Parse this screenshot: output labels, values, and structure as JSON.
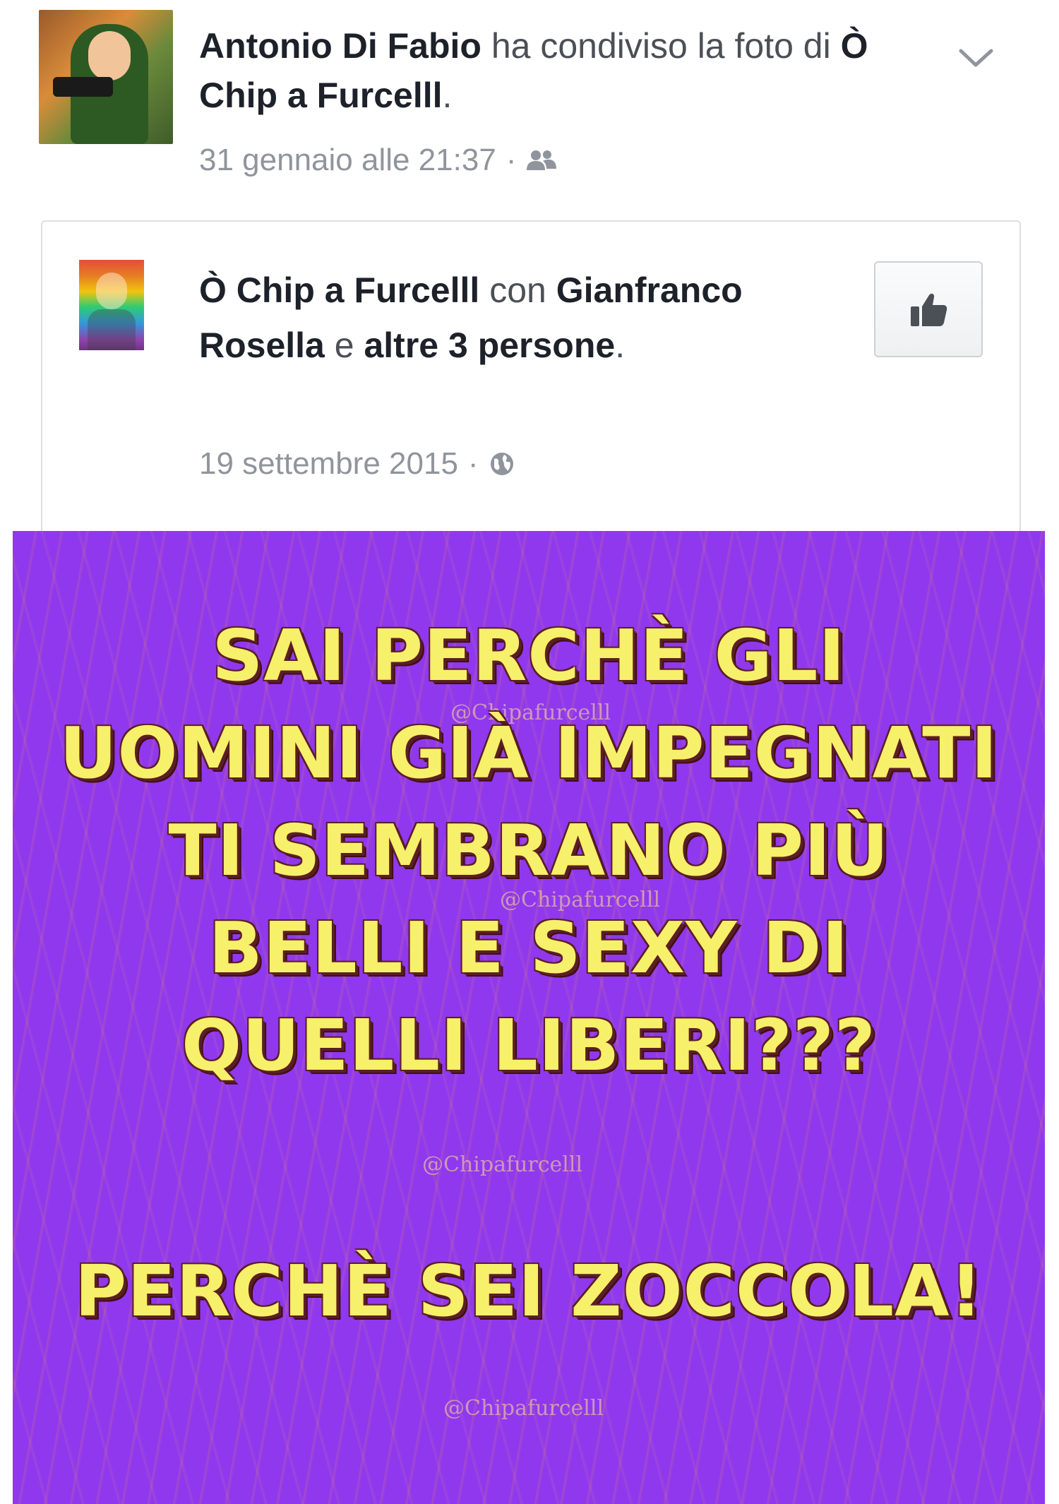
{
  "share": {
    "sharer_name": "Antonio Di Fabio",
    "action_text": "ha condiviso la foto di",
    "page_name": "Ò Chip a Furcelll",
    "period": ".",
    "timestamp": "31 gennaio alle 21:37",
    "separator": "·",
    "audience_icon": "friends-icon",
    "menu_icon": "chevron-down-icon"
  },
  "post": {
    "page_name": "Ò Chip a Furcelll",
    "with_text": "con",
    "tagged_name": "Gianfranco Rosella",
    "and_text": "e",
    "others": "altre 3 persone",
    "period": ".",
    "timestamp": "19 settembre 2015",
    "separator": "·",
    "audience_icon": "globe-icon",
    "like_icon": "thumbs-up-icon"
  },
  "meme": {
    "background_color": "#8f38ee",
    "text_color": "#f7f06a",
    "lines": [
      "SAI PERCHÈ GLI",
      "UOMINI GIÀ IMPEGNATI",
      "TI SEMBRANO PIÙ",
      "BELLI E SEXY DI",
      "QUELLI LIBERI???"
    ],
    "punchline": "PERCHÈ SEI ZOCCOLA!",
    "watermark": "@Chipafurcelll"
  }
}
